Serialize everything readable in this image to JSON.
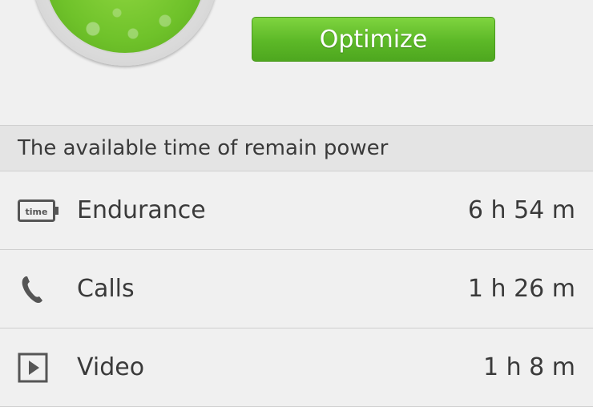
{
  "optimize_label": "Optimize",
  "section_title": "The available time of remain power",
  "items": [
    {
      "label": "Endurance",
      "value": "6 h 54 m",
      "icon": "battery-time-icon",
      "icon_text": "time"
    },
    {
      "label": "Calls",
      "value": "1 h 26 m",
      "icon": "phone-icon"
    },
    {
      "label": "Video",
      "value": "1 h 8 m",
      "icon": "video-play-icon"
    }
  ],
  "colors": {
    "accent": "#5cb827",
    "background": "#efefef",
    "text": "#3a3a3a"
  }
}
